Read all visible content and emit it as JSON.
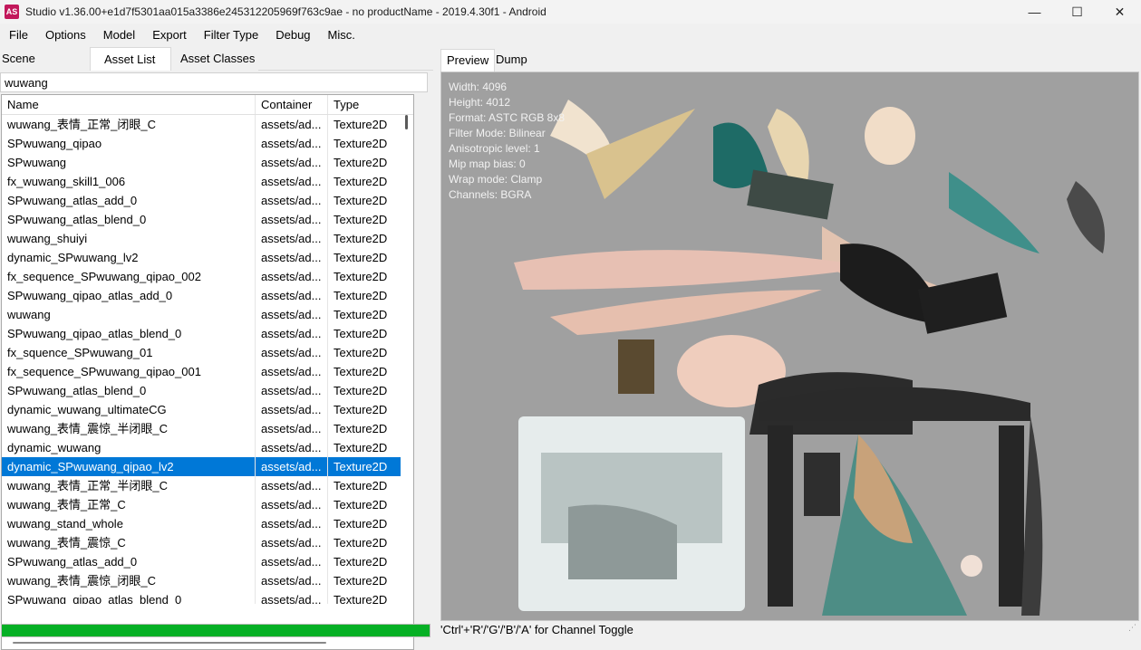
{
  "window": {
    "app_icon_text": "AS",
    "title": "Studio v1.36.00+e1d7f5301aa015a3386e245312205969f763c9ae - no productName - 2019.4.30f1 - Android",
    "minimize": "—",
    "maximize": "☐",
    "close": "✕"
  },
  "menu": [
    "File",
    "Options",
    "Model",
    "Export",
    "Filter Type",
    "Debug",
    "Misc."
  ],
  "left_tabs": [
    "Scene Hierarchy",
    "Asset List",
    "Asset Classes"
  ],
  "filter_value": "wuwang",
  "columns": [
    "Name",
    "Container",
    "Type"
  ],
  "rows": [
    {
      "name": "wuwang_表情_正常_闭眼_C",
      "container": "assets/ad...",
      "type": "Texture2D"
    },
    {
      "name": "SPwuwang_qipao",
      "container": "assets/ad...",
      "type": "Texture2D"
    },
    {
      "name": "SPwuwang",
      "container": "assets/ad...",
      "type": "Texture2D"
    },
    {
      "name": "fx_wuwang_skill1_006",
      "container": "assets/ad...",
      "type": "Texture2D"
    },
    {
      "name": "SPwuwang_atlas_add_0",
      "container": "assets/ad...",
      "type": "Texture2D"
    },
    {
      "name": "SPwuwang_atlas_blend_0",
      "container": "assets/ad...",
      "type": "Texture2D"
    },
    {
      "name": "wuwang_shuiyi",
      "container": "assets/ad...",
      "type": "Texture2D"
    },
    {
      "name": "dynamic_SPwuwang_lv2",
      "container": "assets/ad...",
      "type": "Texture2D"
    },
    {
      "name": "fx_sequence_SPwuwang_qipao_002",
      "container": "assets/ad...",
      "type": "Texture2D"
    },
    {
      "name": "SPwuwang_qipao_atlas_add_0",
      "container": "assets/ad...",
      "type": "Texture2D"
    },
    {
      "name": "wuwang",
      "container": "assets/ad...",
      "type": "Texture2D"
    },
    {
      "name": "SPwuwang_qipao_atlas_blend_0",
      "container": "assets/ad...",
      "type": "Texture2D"
    },
    {
      "name": "fx_squence_SPwuwang_01",
      "container": "assets/ad...",
      "type": "Texture2D"
    },
    {
      "name": "fx_sequence_SPwuwang_qipao_001",
      "container": "assets/ad...",
      "type": "Texture2D"
    },
    {
      "name": "SPwuwang_atlas_blend_0",
      "container": "assets/ad...",
      "type": "Texture2D"
    },
    {
      "name": "dynamic_wuwang_ultimateCG",
      "container": "assets/ad...",
      "type": "Texture2D"
    },
    {
      "name": "wuwang_表情_震惊_半闭眼_C",
      "container": "assets/ad...",
      "type": "Texture2D"
    },
    {
      "name": "dynamic_wuwang",
      "container": "assets/ad...",
      "type": "Texture2D"
    },
    {
      "name": "dynamic_SPwuwang_qipao_lv2",
      "container": "assets/ad...",
      "type": "Texture2D",
      "selected": true
    },
    {
      "name": "wuwang_表情_正常_半闭眼_C",
      "container": "assets/ad...",
      "type": "Texture2D"
    },
    {
      "name": "wuwang_表情_正常_C",
      "container": "assets/ad...",
      "type": "Texture2D"
    },
    {
      "name": "wuwang_stand_whole",
      "container": "assets/ad...",
      "type": "Texture2D"
    },
    {
      "name": "wuwang_表情_震惊_C",
      "container": "assets/ad...",
      "type": "Texture2D"
    },
    {
      "name": "SPwuwang_atlas_add_0",
      "container": "assets/ad...",
      "type": "Texture2D"
    },
    {
      "name": "wuwang_表情_震惊_闭眼_C",
      "container": "assets/ad...",
      "type": "Texture2D"
    },
    {
      "name": "SPwuwang_qipao_atlas_blend_0",
      "container": "assets/ad...",
      "type": "Texture2D"
    }
  ],
  "progress_fraction": 1.0,
  "right_tabs": [
    "Preview",
    "Dump"
  ],
  "texture_info": [
    "Width: 4096",
    "Height: 4012",
    "Format: ASTC RGB 8x8",
    "Filter Mode: Bilinear",
    "Anisotropic level: 1",
    "Mip map bias: 0",
    "Wrap mode: Clamp",
    "Channels: BGRA"
  ],
  "status_text": "'Ctrl'+'R'/'G'/'B'/'A' for Channel Toggle",
  "colors": {
    "selection": "#0078d7",
    "progress": "#06b025",
    "preview_bg": "#a0a0a0"
  }
}
